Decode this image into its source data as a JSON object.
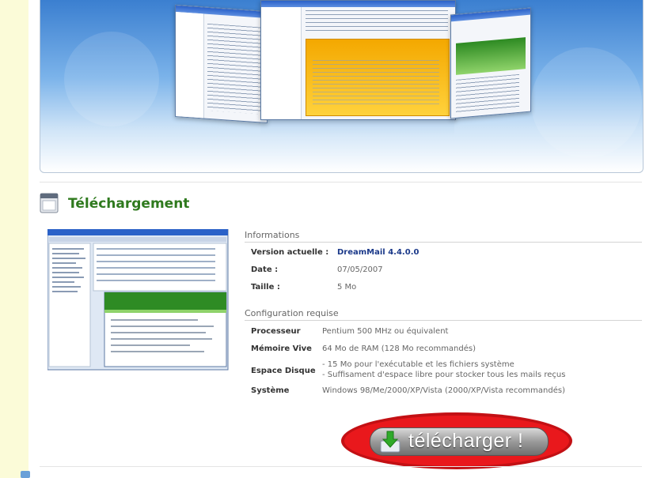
{
  "banner": {
    "description": ""
  },
  "section": {
    "title": "Téléchargement"
  },
  "informations": {
    "heading": "Informations",
    "rows": [
      {
        "label": "Version actuelle :",
        "value": "DreamMail 4.4.0.0"
      },
      {
        "label": "Date :",
        "value": "07/05/2007"
      },
      {
        "label": "Taille :",
        "value": "5 Mo"
      }
    ]
  },
  "configuration": {
    "heading": "Configuration requise",
    "rows": [
      {
        "label": "Processeur",
        "value": "Pentium 500 MHz ou équivalent"
      },
      {
        "label": "Mémoire Vive",
        "value": "64 Mo de RAM (128 Mo recommandés)"
      },
      {
        "label": "Espace Disque",
        "value_line1": "- 15 Mo pour l'exécutable et les fichiers système",
        "value_line2": "- Suffisament d'espace libre pour stocker tous les mails reçus"
      },
      {
        "label": "Système",
        "value": "Windows 98/Me/2000/XP/Vista (2000/XP/Vista recommandés)"
      }
    ]
  },
  "download": {
    "label": "télécharger !"
  },
  "colors": {
    "accent_green": "#2f7a1e",
    "highlight_red": "#e9181c",
    "version_blue": "#1c3a8a"
  },
  "icons": [
    "window-icon",
    "download-arrow-icon"
  ]
}
